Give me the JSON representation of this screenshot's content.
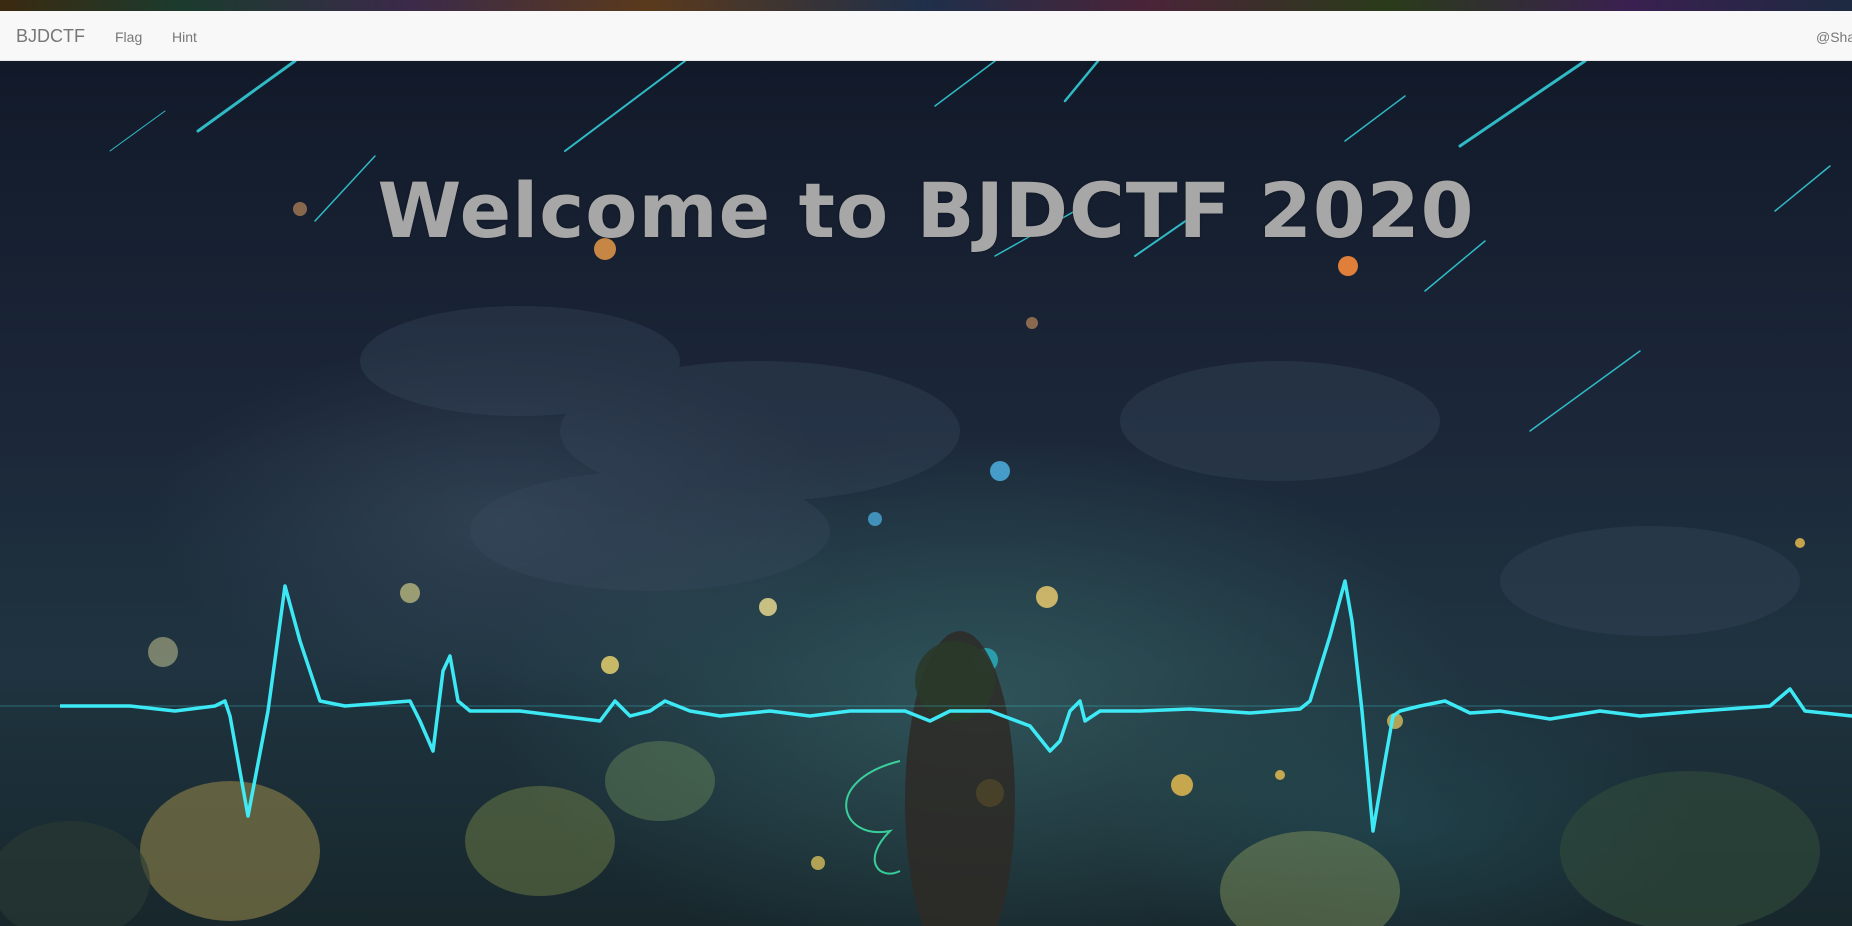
{
  "navbar": {
    "brand": "BJDCTF",
    "links": [
      {
        "label": "Flag"
      },
      {
        "label": "Hint"
      }
    ],
    "user": "@Sha"
  },
  "hero": {
    "title": "Welcome to BJDCTF 2020"
  },
  "colors": {
    "navbar_bg": "#f8f8f8",
    "nav_text": "#777777",
    "title_text": "#a7a7a7",
    "heartbeat": "#3ff2ff"
  },
  "icons": {
    "background": "night-sky-heartbeat-illustration"
  }
}
